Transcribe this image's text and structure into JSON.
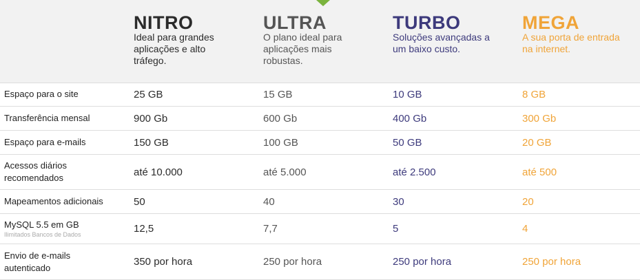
{
  "colors": {
    "nitro": "#2b2b2b",
    "ultra": "#555555",
    "turbo": "#3d3a7c",
    "mega": "#f0a438",
    "pointer": "#7ab33d"
  },
  "plans": [
    {
      "name": "NITRO",
      "desc": [
        "Ideal para grandes",
        "aplicações e alto",
        "tráfego."
      ]
    },
    {
      "name": "ULTRA",
      "desc": [
        "O plano ideal para",
        "aplicações mais",
        "robustas."
      ]
    },
    {
      "name": "TURBO",
      "desc": [
        "Soluções avançadas a",
        "um baixo custo."
      ]
    },
    {
      "name": "MEGA",
      "desc": [
        "A sua porta de entrada",
        "na internet."
      ]
    }
  ],
  "rows": [
    {
      "label": [
        "Espaço para o site"
      ],
      "values": [
        "25 GB",
        "15 GB",
        "10 GB",
        "8 GB"
      ]
    },
    {
      "label": [
        "Transferência mensal"
      ],
      "values": [
        "900 Gb",
        "600 Gb",
        "400 Gb",
        "300 Gb"
      ]
    },
    {
      "label": [
        "Espaço para e-mails"
      ],
      "values": [
        "150 GB",
        "100 GB",
        "50 GB",
        "20 GB"
      ]
    },
    {
      "label": [
        "Acessos diários",
        "recomendados"
      ],
      "values": [
        "até 10.000",
        "até 5.000",
        "até 2.500",
        "até 500"
      ]
    },
    {
      "label": [
        "Mapeamentos adicionais"
      ],
      "values": [
        "50",
        "40",
        "30",
        "20"
      ]
    },
    {
      "label": [
        "MySQL 5.5 em GB"
      ],
      "sublabel": "Ilimitados Bancos de Dados",
      "values": [
        "12,5",
        "7,7",
        "5",
        "4"
      ]
    },
    {
      "label": [
        "Envio de e-mails",
        "autenticado"
      ],
      "values": [
        "350 por hora",
        "250 por hora",
        "250 por hora",
        "250 por hora"
      ]
    }
  ]
}
